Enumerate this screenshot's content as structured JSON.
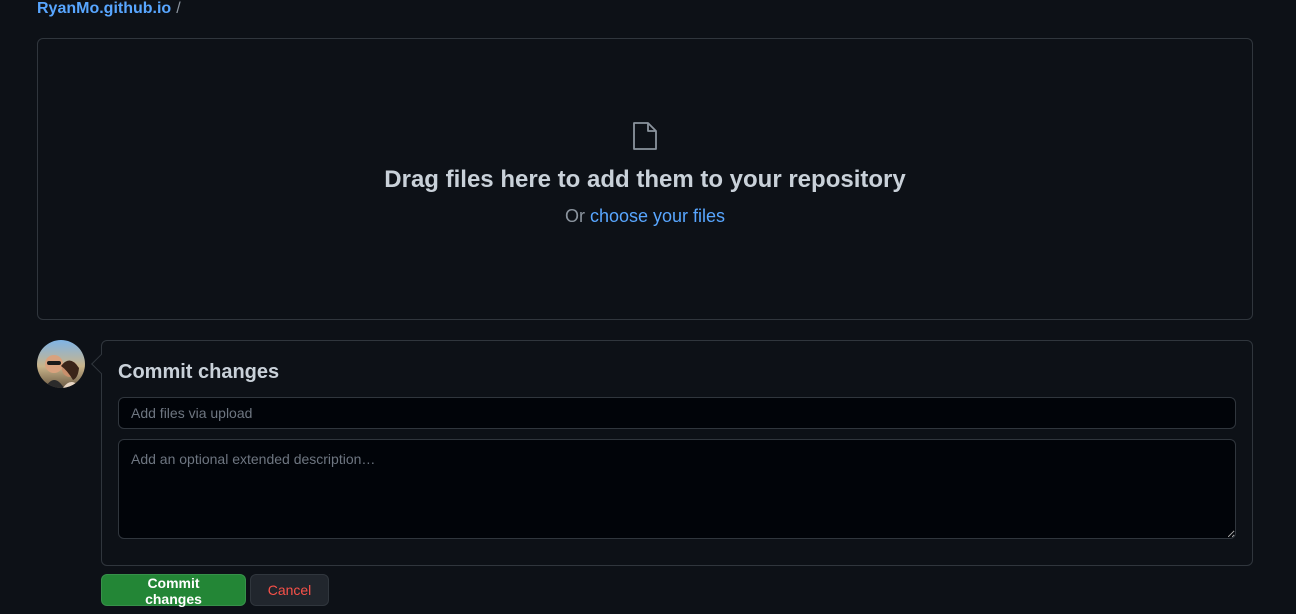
{
  "breadcrumb": {
    "repo": "RyanMo.github.io",
    "separator": "/"
  },
  "dropzone": {
    "icon": "file-icon",
    "title": "Drag files here to add them to your repository",
    "or_text": "Or",
    "choose_link": "choose your files"
  },
  "commit": {
    "heading": "Commit changes",
    "summary_value": "",
    "summary_placeholder": "Add files via upload",
    "description_value": "",
    "description_placeholder": "Add an optional extended description…",
    "submit_label": "Commit changes",
    "cancel_label": "Cancel"
  },
  "colors": {
    "background": "#0d1117",
    "link": "#58a6ff",
    "primary_button": "#238636",
    "danger_text": "#f85149",
    "border": "#30363d"
  }
}
